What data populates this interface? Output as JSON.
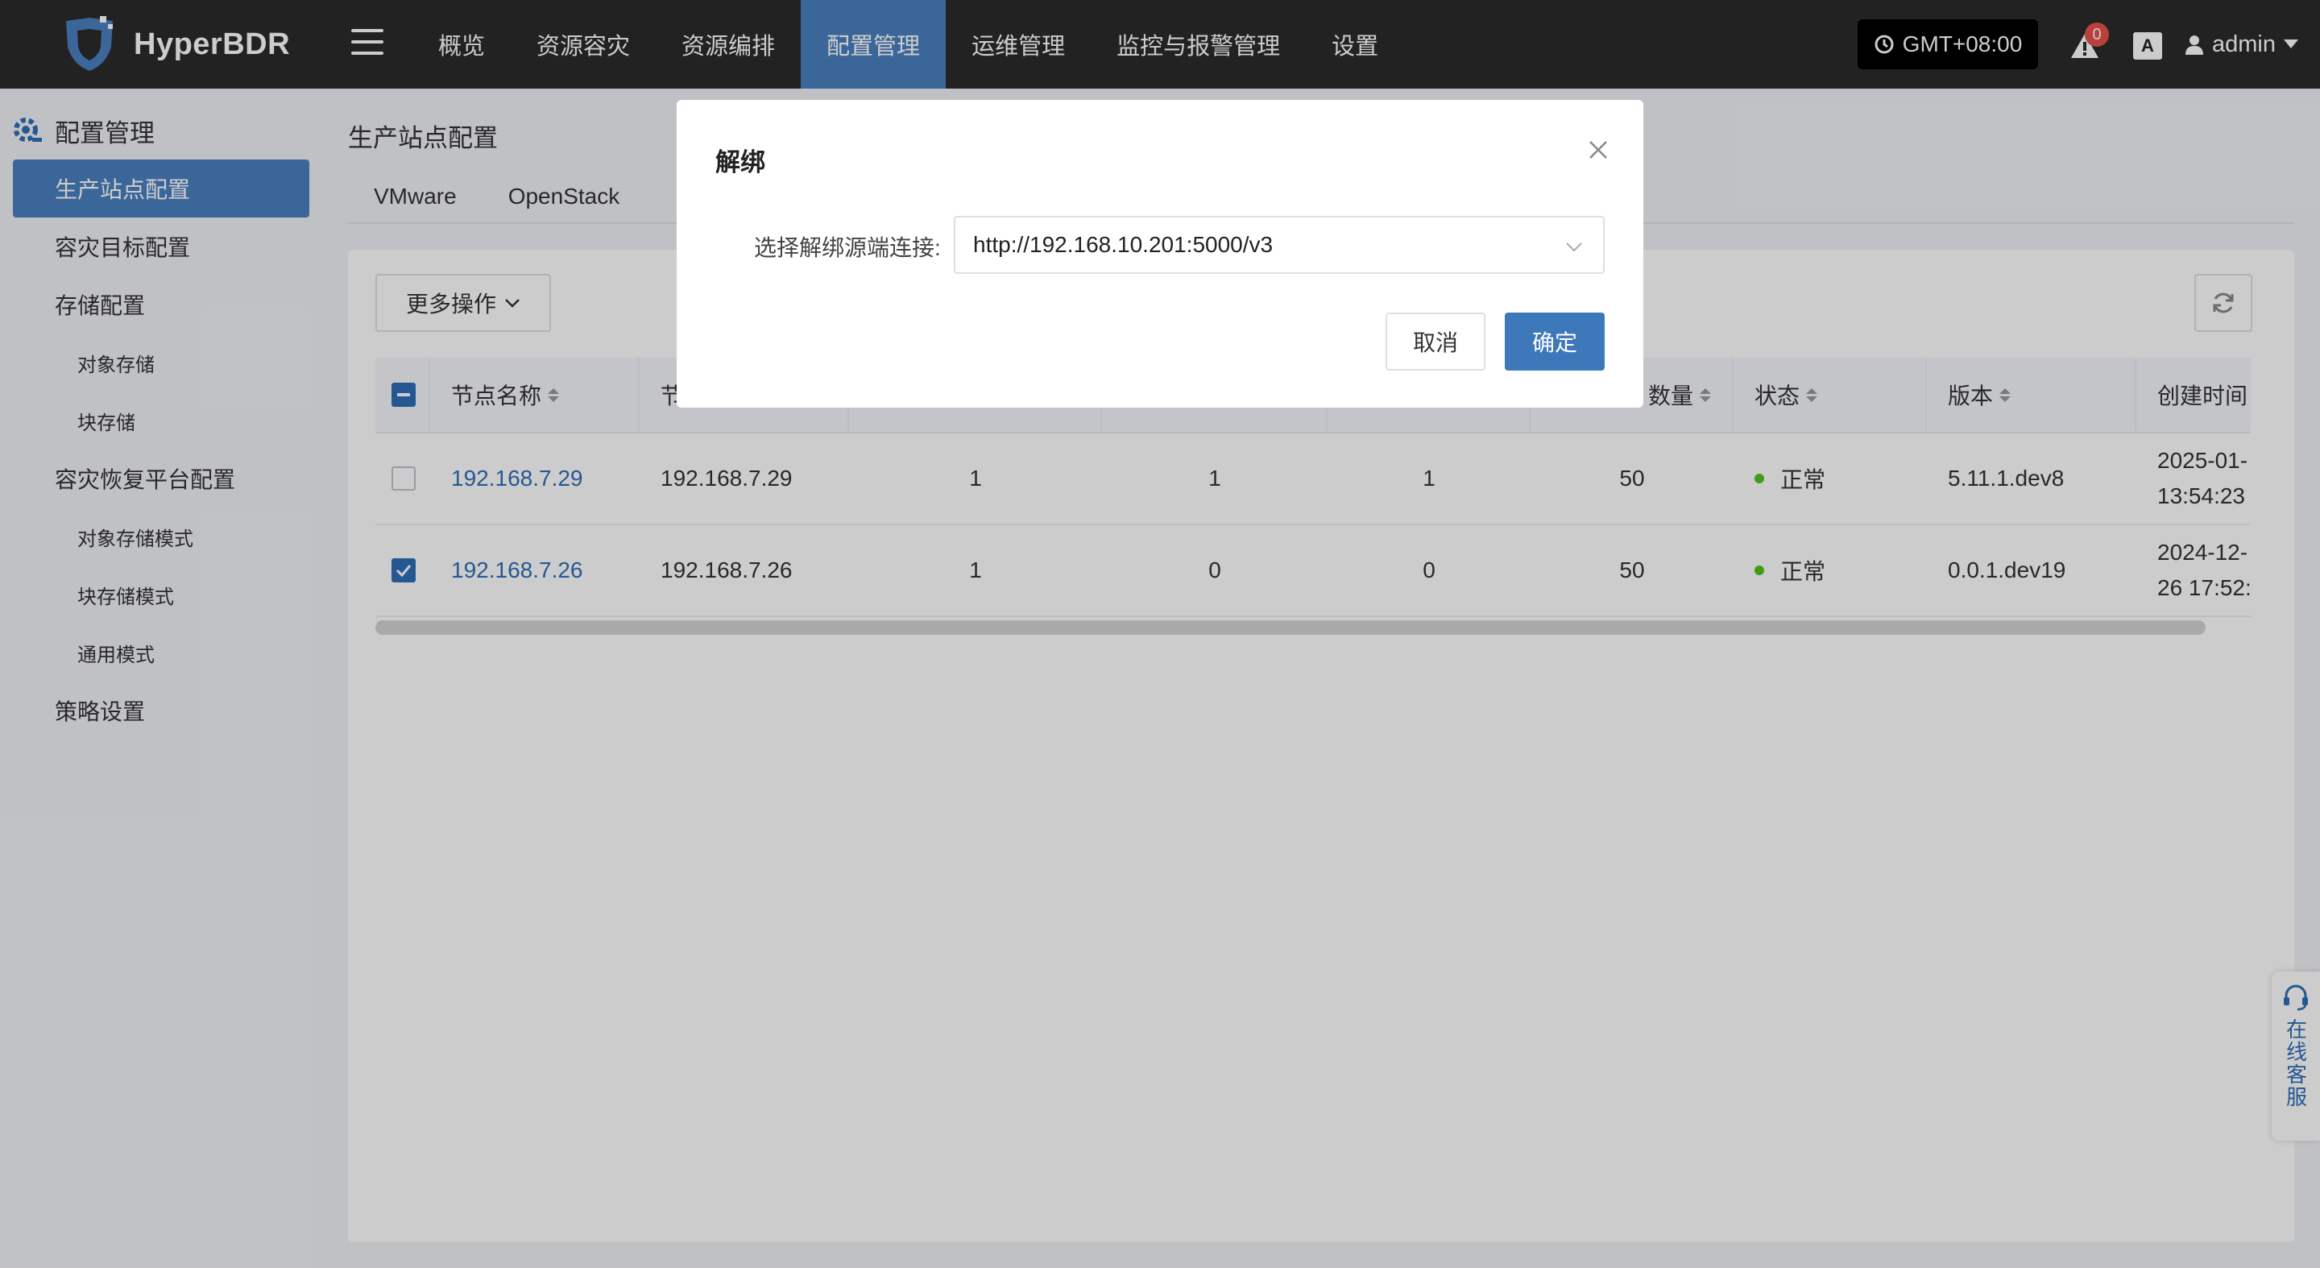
{
  "app": {
    "name": "HyperBDR"
  },
  "nav": {
    "items": [
      "概览",
      "资源容灾",
      "资源编排",
      "配置管理",
      "运维管理",
      "监控与报警管理",
      "设置"
    ],
    "active_index": 3
  },
  "header": {
    "timezone": "GMT+08:00",
    "alert_count": "0",
    "lang_icon": "A",
    "user": "admin"
  },
  "sidebar": {
    "title": "配置管理",
    "items": [
      {
        "label": "生产站点配置",
        "active": true
      },
      {
        "label": "容灾目标配置"
      },
      {
        "label": "存储配置"
      },
      {
        "label": "对象存储",
        "sub": true
      },
      {
        "label": "块存储",
        "sub": true
      },
      {
        "label": "容灾恢复平台配置"
      },
      {
        "label": "对象存储模式",
        "sub": true
      },
      {
        "label": "块存储模式",
        "sub": true
      },
      {
        "label": "通用模式",
        "sub": true
      },
      {
        "label": "策略设置"
      }
    ]
  },
  "main": {
    "title": "生产站点配置",
    "tabs": [
      "VMware",
      "OpenStack"
    ],
    "more_actions": "更多操作",
    "table": {
      "headers": [
        "节点名称",
        "节",
        "",
        "",
        "",
        "数量",
        "状态",
        "版本",
        "创建时间"
      ],
      "rows": [
        {
          "checked": false,
          "name": "192.168.7.29",
          "ip": "192.168.7.29",
          "c1": "1",
          "c2": "1",
          "c3": "1",
          "count": "50",
          "status": "正常",
          "version": "5.11.1.dev8",
          "created_1": "2025-01-",
          "created_2": "13:54:23"
        },
        {
          "checked": true,
          "name": "192.168.7.26",
          "ip": "192.168.7.26",
          "c1": "1",
          "c2": "0",
          "c3": "0",
          "count": "50",
          "status": "正常",
          "version": "0.0.1.dev19",
          "created_1": "2024-12-",
          "created_2": "26 17:52:"
        }
      ]
    }
  },
  "modal": {
    "title": "解绑",
    "field_label": "选择解绑源端连接:",
    "selected_value": "http://192.168.10.201:5000/v3",
    "cancel": "取消",
    "confirm": "确定"
  },
  "support": {
    "label": "在线客服"
  },
  "colors": {
    "accent": "#4a80c0",
    "topbar": "#2b2b2b",
    "status_ok": "#52c41a",
    "link": "#2f6fb8"
  }
}
